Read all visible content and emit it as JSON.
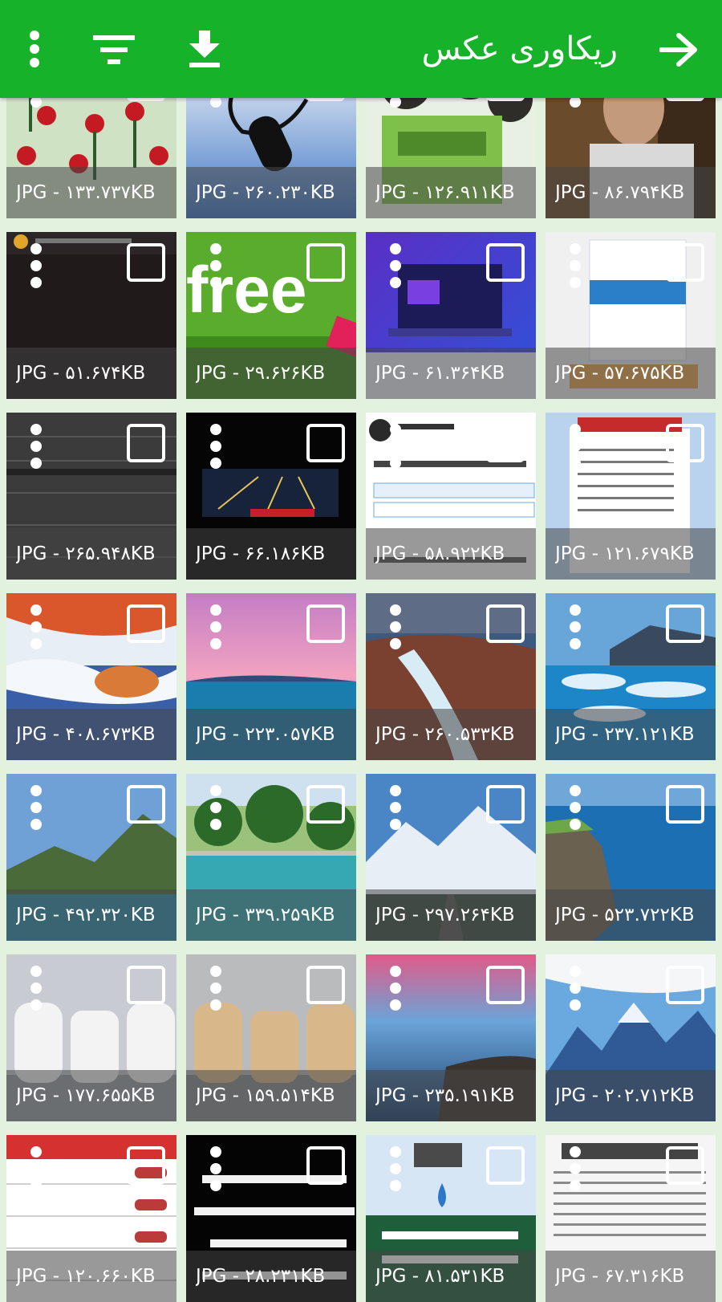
{
  "header": {
    "title": "ریکاوری عکس",
    "background": "#16b22a",
    "icons": [
      "more-vert-icon",
      "filter-icon",
      "download-icon",
      "arrow-forward-icon"
    ]
  },
  "files": [
    {
      "caption": "JPG - ۱۳۳.۷۳۷KB",
      "thumb": "flowers"
    },
    {
      "caption": "JPG - ۲۶۰.۲۳۰KB",
      "thumb": "telephone"
    },
    {
      "caption": "JPG - ۱۲۶.۹۱۱KB",
      "thumb": "snack-cans"
    },
    {
      "caption": "JPG - ۸۶.۷۹۴KB",
      "thumb": "portrait"
    },
    {
      "caption": "JPG - ۵۱.۶۷۴KB",
      "thumb": "phone-screen"
    },
    {
      "caption": "JPG - ۲۹.۶۲۶KB",
      "thumb": "free-banner"
    },
    {
      "caption": "JPG - ۶۱.۳۶۴KB",
      "thumb": "net-developer"
    },
    {
      "caption": "JPG - ۵۷.۶۷۵KB",
      "thumb": "book-cover"
    },
    {
      "caption": "JPG - ۲۶۵.۹۴۸KB",
      "thumb": "dark-texture"
    },
    {
      "caption": "JPG - ۶۶.۱۸۶KB",
      "thumb": "night-highway"
    },
    {
      "caption": "JPG - ۵۸.۹۲۲KB",
      "thumb": "tweet-poll"
    },
    {
      "caption": "JPG - ۱۲۱.۶۷۹KB",
      "thumb": "document"
    },
    {
      "caption": "JPG - ۴۰۸.۶۷۳KB",
      "thumb": "snowy-lake"
    },
    {
      "caption": "JPG - ۲۲۳.۰۵۷KB",
      "thumb": "pink-sky-sea"
    },
    {
      "caption": "JPG - ۲۶۰.۵۳۳KB",
      "thumb": "waterfall"
    },
    {
      "caption": "JPG - ۲۳۷.۱۲۱KB",
      "thumb": "glacier-lake"
    },
    {
      "caption": "JPG - ۴۹۲.۳۲۰KB",
      "thumb": "mountain-lake"
    },
    {
      "caption": "JPG - ۳۳۹.۲۵۹KB",
      "thumb": "green-pool"
    },
    {
      "caption": "JPG - ۲۹۷.۲۶۴KB",
      "thumb": "mountain-road"
    },
    {
      "caption": "JPG - ۵۲۳.۷۲۲KB",
      "thumb": "sea-cliff"
    },
    {
      "caption": "JPG - ۱۷۷.۶۵۵KB",
      "thumb": "white-furniture"
    },
    {
      "caption": "JPG - ۱۵۹.۵۱۴KB",
      "thumb": "gold-furniture"
    },
    {
      "caption": "JPG - ۲۳۵.۱۹۱KB",
      "thumb": "misty-sea"
    },
    {
      "caption": "JPG - ۲۰۲.۷۱۲KB",
      "thumb": "snowy-peaks"
    },
    {
      "caption": "JPG - ۱۲۰.۶۶۰KB",
      "thumb": "car-price-table"
    },
    {
      "caption": "JPG - ۲۸.۲۳۱KB",
      "thumb": "black-text-poster"
    },
    {
      "caption": "JPG - ۸۱.۵۳۱KB",
      "thumb": "water-notice"
    },
    {
      "caption": "JPG - ۶۷.۳۱۶KB",
      "thumb": "newspaper-page"
    }
  ]
}
